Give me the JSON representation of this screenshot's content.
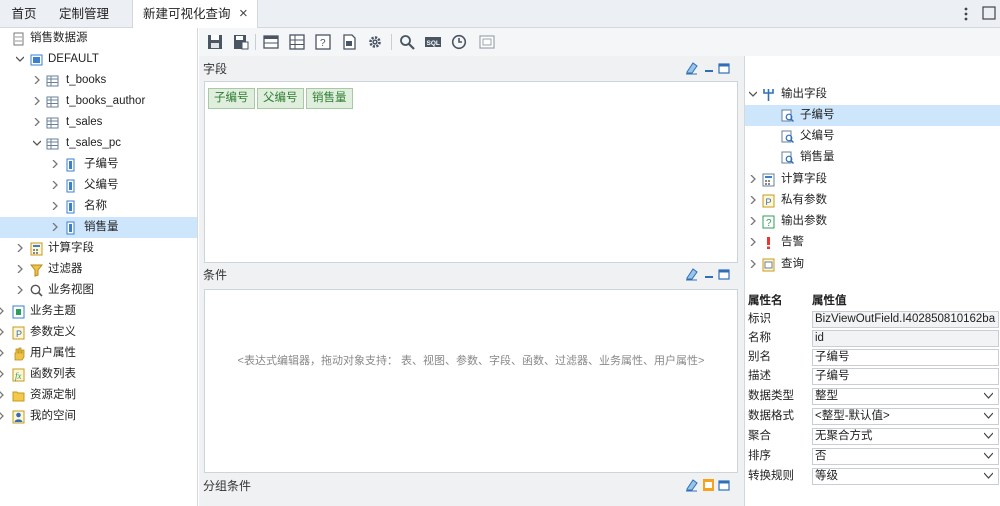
{
  "tabs": [
    {
      "label": "首页"
    },
    {
      "label": "定制管理"
    },
    {
      "label": "新建可视化查询"
    }
  ],
  "tree": {
    "root": "销售数据源",
    "schema": "DEFAULT",
    "tables": [
      "t_books",
      "t_books_author",
      "t_sales",
      "t_sales_pc"
    ],
    "fields": [
      "子编号",
      "父编号",
      "名称",
      "销售量"
    ],
    "sub_nodes": [
      "计算字段",
      "过滤器",
      "业务视图"
    ],
    "top_nodes": [
      "业务主题",
      "参数定义",
      "用户属性",
      "函数列表",
      "资源定制",
      "我的空间"
    ]
  },
  "panels": {
    "fields_title": "字段",
    "field_chips": [
      "子编号",
      "父编号",
      "销售量"
    ],
    "cond_title": "条件",
    "cond_hint": "<表达式编辑器，拖动对象支持： 表、视图、参数、字段、函数、过滤器、业务属性、用户属性>",
    "group_title": "分组条件"
  },
  "outline": {
    "output_fields": "输出字段",
    "fields": [
      "子编号",
      "父编号",
      "销售量"
    ],
    "others": [
      "计算字段",
      "私有参数",
      "输出参数",
      "告警",
      "查询"
    ]
  },
  "props": {
    "header_name": "属性名",
    "header_value": "属性值",
    "rows": [
      {
        "name": "标识",
        "value": "BizViewOutField.I402850810162ba"
      },
      {
        "name": "名称",
        "value": "id"
      },
      {
        "name": "别名",
        "value": "子编号"
      },
      {
        "name": "描述",
        "value": "子编号"
      },
      {
        "name": "数据类型",
        "value": "整型"
      },
      {
        "name": "数据格式",
        "value": "<整型-默认值>"
      },
      {
        "name": "聚合",
        "value": "无聚合方式"
      },
      {
        "name": "排序",
        "value": "否"
      },
      {
        "name": "转换规则",
        "value": "等级"
      }
    ]
  },
  "colors": {
    "selection": "#cde6fb",
    "accent_blue": "#1e6fc8",
    "chip_green": "#2e7d32"
  }
}
